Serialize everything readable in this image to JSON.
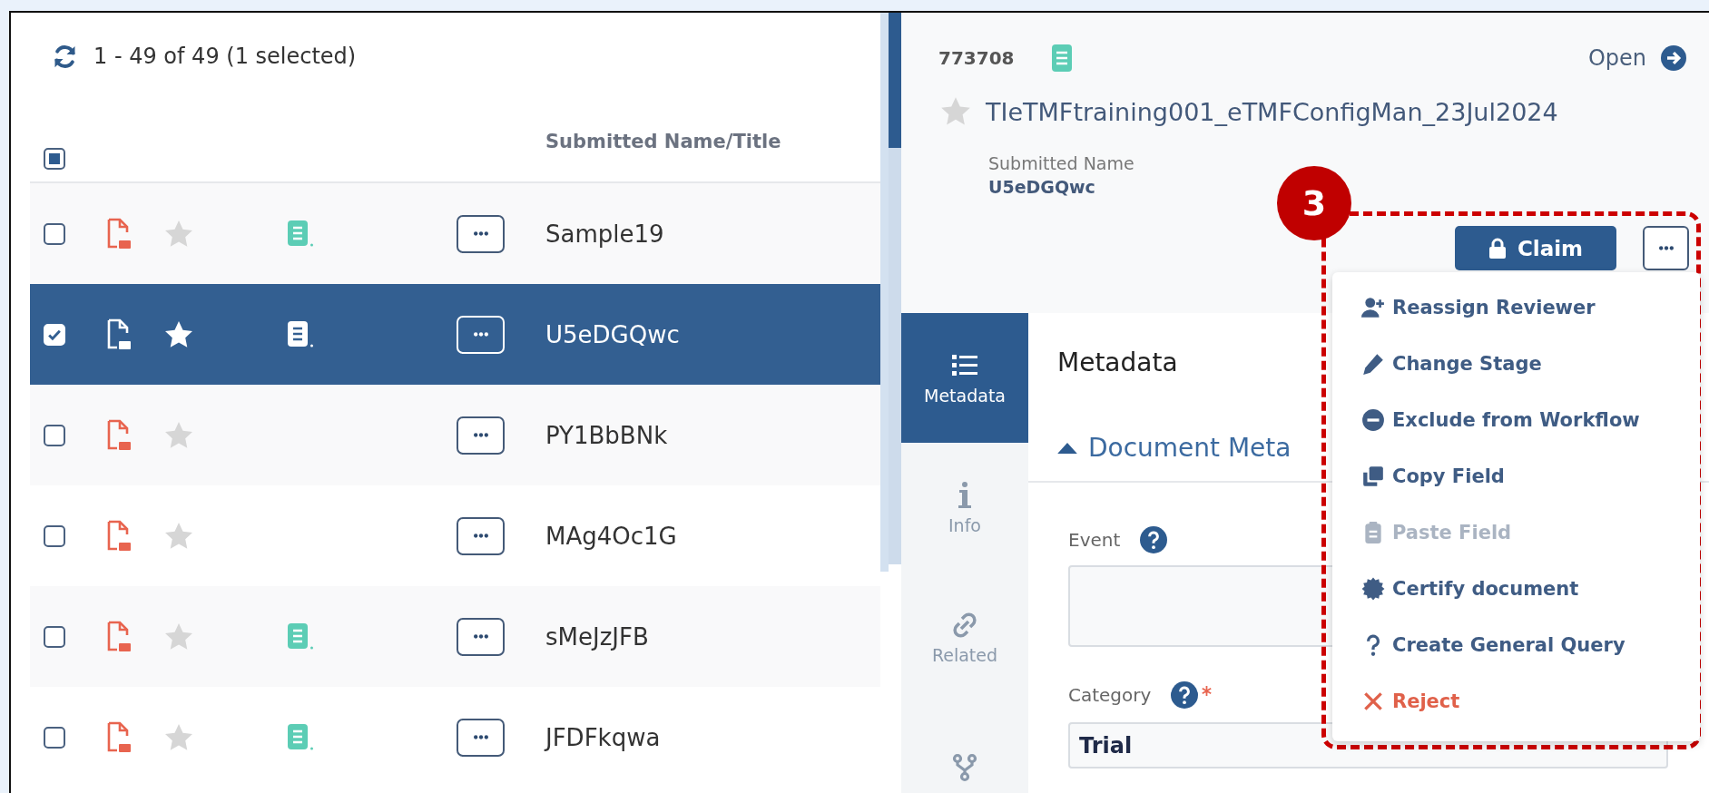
{
  "list": {
    "summary": "1 - 49 of 49 (1 selected)",
    "select_all_partial": true,
    "column_header": "Submitted Name/Title",
    "rows": [
      {
        "name": "Sample19",
        "checked": false,
        "selected": false,
        "has_document": true
      },
      {
        "name": "U5eDGQwc",
        "checked": true,
        "selected": true,
        "has_document": true
      },
      {
        "name": "PY1BbBNk",
        "checked": false,
        "selected": false,
        "has_document": false
      },
      {
        "name": "MAg4Oc1G",
        "checked": false,
        "selected": false,
        "has_document": false
      },
      {
        "name": "sMeJzJFB",
        "checked": false,
        "selected": false,
        "has_document": true
      },
      {
        "name": "JFDFkqwa",
        "checked": false,
        "selected": false,
        "has_document": true
      }
    ]
  },
  "detail": {
    "id": "773708",
    "open_label": "Open",
    "title": "TIeTMFtraining001_eTMFConfigMan_23Jul2024",
    "submitted_label": "Submitted Name",
    "submitted_value": "U5eDGQwc",
    "claim_label": "Claim",
    "tabs": [
      {
        "label": "Metadata",
        "selected": true
      },
      {
        "label": "Info",
        "selected": false
      },
      {
        "label": "Related",
        "selected": false
      },
      {
        "selected": false
      }
    ],
    "section_title": "Metadata",
    "subsection": {
      "title": "Document Meta",
      "expanded": true
    },
    "fields": [
      {
        "kind": "textarea",
        "label": "Event",
        "required": false
      },
      {
        "kind": "select",
        "label": "Category",
        "required": true,
        "value": "Trial"
      }
    ],
    "menu": [
      {
        "label": "Reassign Reviewer",
        "kind": "normal",
        "disabled": false
      },
      {
        "label": "Change Stage",
        "kind": "normal",
        "disabled": false
      },
      {
        "label": "Exclude from Workflow",
        "kind": "normal",
        "disabled": false
      },
      {
        "label": "Copy Field",
        "kind": "normal",
        "disabled": false
      },
      {
        "label": "Paste Field",
        "kind": "normal",
        "disabled": true
      },
      {
        "label": "Certify document",
        "kind": "normal",
        "disabled": false
      },
      {
        "label": "Create General Query",
        "kind": "normal",
        "disabled": false
      },
      {
        "label": "Reject",
        "kind": "danger",
        "disabled": false
      }
    ]
  },
  "annotation": {
    "badge": "3"
  }
}
